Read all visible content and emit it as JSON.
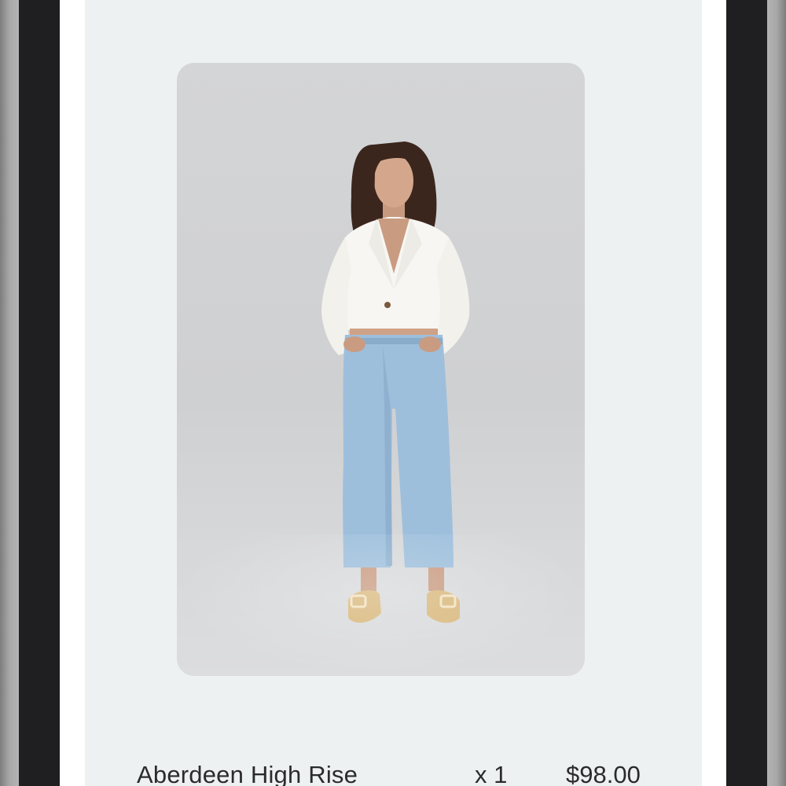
{
  "cart": {
    "items": [
      {
        "image_alt": "Model wearing white cropped blazer and light wash wide leg jeans",
        "name": "Aberdeen High Rise",
        "quantity": "x 1",
        "price": "$98.00"
      }
    ]
  },
  "colors": {
    "page_background": "#eef1f2",
    "device_bezel": "#1f1f21",
    "text": "#2b2b2e",
    "denim": "#9ebfdc",
    "blazer": "#f7f6f2"
  }
}
